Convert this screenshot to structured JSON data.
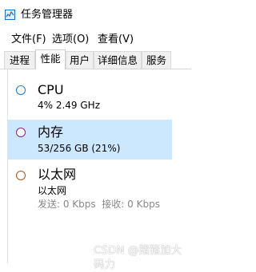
{
  "window": {
    "title": "任务管理器"
  },
  "menu": [
    "文件(F)",
    "选项(O)",
    "查看(V)"
  ],
  "tabs": [
    "进程",
    "性能",
    "用户",
    "详细信息",
    "服务"
  ],
  "active_tab": "性能",
  "resources": {
    "cpu": {
      "name": "CPU",
      "detail": "4% 2.49 GHz",
      "color": "#1b7ac7"
    },
    "memory": {
      "name": "内存",
      "detail": "53/256 GB (21%)",
      "color": "#8b1b8b",
      "selected": true
    },
    "ethernet": {
      "name": "以太网",
      "detail": "以太网",
      "detail2": "发送: 0 Kbps  接收: 0 Kbps",
      "color": "#a85a12"
    }
  },
  "watermark": "CSDN @猪猪加大码力",
  "colors": {
    "selection": "#cce8ff",
    "tab_inactive": "#f0f0f0"
  }
}
